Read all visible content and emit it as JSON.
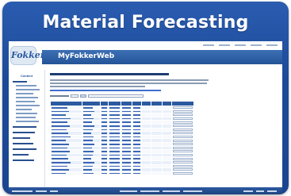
{
  "frame": {
    "title": "Material Forecasting"
  },
  "app": {
    "logo_text": "Fokker",
    "site_title": "MyFokkerWeb",
    "sidebar_heading": "Content"
  },
  "icons": {
    "logo": "fokker-logo-icon"
  },
  "colors": {
    "frame_blue": "#1d4a98",
    "brand_bar": "#245498",
    "table_header": "#2c5aa0",
    "link": "#3e6fd0"
  }
}
